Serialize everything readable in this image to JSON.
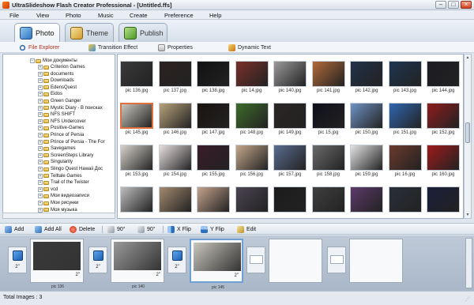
{
  "window": {
    "title": "UltraSlideshow Flash Creator Professional - [Untitled.ffs]"
  },
  "menu": [
    "File",
    "View",
    "Photo",
    "Music",
    "Create",
    "Preference",
    "Help"
  ],
  "main_tabs": [
    {
      "label": "Photo",
      "icon": "photo-icon",
      "active": true
    },
    {
      "label": "Theme",
      "icon": "theme-icon",
      "active": false
    },
    {
      "label": "Publish",
      "icon": "publish-icon",
      "active": false
    }
  ],
  "sub_tabs": [
    {
      "label": "File Explorer",
      "icon": "magnifier-icon",
      "active": true
    },
    {
      "label": "Transition Effect",
      "icon": "transition-icon",
      "active": false
    },
    {
      "label": "Properties",
      "icon": "properties-icon",
      "active": false
    },
    {
      "label": "Dynamic Text",
      "icon": "dynamic-text-icon",
      "active": false
    }
  ],
  "tree": {
    "root": "Мои документы",
    "items": [
      "Criterion Games",
      "documents",
      "Downloads",
      "EdensQuest",
      "Eidos",
      "Green Ganger",
      "Mystic Diary - В поисках",
      "NFS SHIFT",
      "NFS Undercover",
      "Positive-Games",
      "Prince of Persia",
      "Prince of Persia - The For",
      "Savegames",
      "ScreenSteps Library",
      "Singularity",
      "Slingo Quest Hawaii Доc",
      "Telltale Games",
      "Trail of the Twister",
      "vcd",
      "Мои видеозаписи",
      "Мои рисунки",
      "Моя музыка"
    ]
  },
  "photos": [
    {
      "label": "pic 136.jpg",
      "color": "#3a3a3a"
    },
    {
      "label": "pic 137.jpg",
      "color": "#2b2220"
    },
    {
      "label": "pic 138.jpg",
      "color": "#111111"
    },
    {
      "label": "pic 14.jpg",
      "color": "#7a2f2a"
    },
    {
      "label": "pic 140.jpg",
      "color": "#9a9a9a"
    },
    {
      "label": "pic 141.jpg",
      "color": "#b26a3a"
    },
    {
      "label": "pic 142.jpg",
      "color": "#23314a"
    },
    {
      "label": "pic 143.jpg",
      "color": "#1e3550"
    },
    {
      "label": "pic 144.jpg",
      "color": "#1b1b22"
    },
    {
      "label": "pic 145.jpg",
      "color": "#c9c6bd",
      "selected": true
    },
    {
      "label": "pic 146.jpg",
      "color": "#b8a27a"
    },
    {
      "label": "pic 147.jpg",
      "color": "#1a1411"
    },
    {
      "label": "pic 148.jpg",
      "color": "#3d6b2a"
    },
    {
      "label": "pic 149.jpg",
      "color": "#2a2624"
    },
    {
      "label": "pic 15.jpg",
      "color": "#0f0f1a"
    },
    {
      "label": "pic 150.jpg",
      "color": "#6f93c4"
    },
    {
      "label": "pic 151.jpg",
      "color": "#2f66b0"
    },
    {
      "label": "pic 152.jpg",
      "color": "#8e1c1c"
    },
    {
      "label": "pic 153.jpg",
      "color": "#d7d3cc"
    },
    {
      "label": "pic 154.jpg",
      "color": "#e8e0e0"
    },
    {
      "label": "pic 155.jpg",
      "color": "#3a1c2a"
    },
    {
      "label": "pic 156.jpg",
      "color": "#c4a78a"
    },
    {
      "label": "pic 157.jpg",
      "color": "#5a6c90"
    },
    {
      "label": "pic 158.jpg",
      "color": "#6a6a6a"
    },
    {
      "label": "pic 159.jpg",
      "color": "#e4e4e4"
    },
    {
      "label": "pic 16.jpg",
      "color": "#6b3a2c"
    },
    {
      "label": "pic 160.jpg",
      "color": "#9e1a1a"
    },
    {
      "label": "",
      "color": "#bdbdbd"
    },
    {
      "label": "",
      "color": "#a48a70"
    },
    {
      "label": "",
      "color": "#c4a38c"
    },
    {
      "label": "",
      "color": "#4a4450"
    },
    {
      "label": "",
      "color": "#1c1c1c"
    },
    {
      "label": "",
      "color": "#3f3f3f"
    },
    {
      "label": "",
      "color": "#5d3a6a"
    },
    {
      "label": "",
      "color": "#2a2f3a"
    },
    {
      "label": "",
      "color": "#1a1e3a"
    }
  ],
  "toolbar": [
    {
      "label": "Add",
      "icon": "add-icon"
    },
    {
      "label": "Add All",
      "icon": "add-all-icon"
    },
    {
      "label": "Delete",
      "icon": "delete-icon"
    },
    {
      "label": "90°",
      "icon": "rotate-left-icon"
    },
    {
      "label": "90°",
      "icon": "rotate-right-icon"
    },
    {
      "label": "X Flip",
      "icon": "x-flip-icon"
    },
    {
      "label": "Y Flip",
      "icon": "y-flip-icon"
    },
    {
      "label": "Edit",
      "icon": "edit-icon"
    }
  ],
  "storyboard": {
    "transitions": [
      "2\"",
      "2\"",
      "2\""
    ],
    "slides": [
      {
        "name": "pic 136",
        "duration": "2\"",
        "color": "#3a3a3a"
      },
      {
        "name": "pic 140",
        "duration": "2\"",
        "color": "#9a9a9a"
      },
      {
        "name": "pic 145",
        "duration": "2\"",
        "color": "#c9c6bd",
        "active": true
      }
    ]
  },
  "status": {
    "total_images": "Total Images : 3"
  }
}
